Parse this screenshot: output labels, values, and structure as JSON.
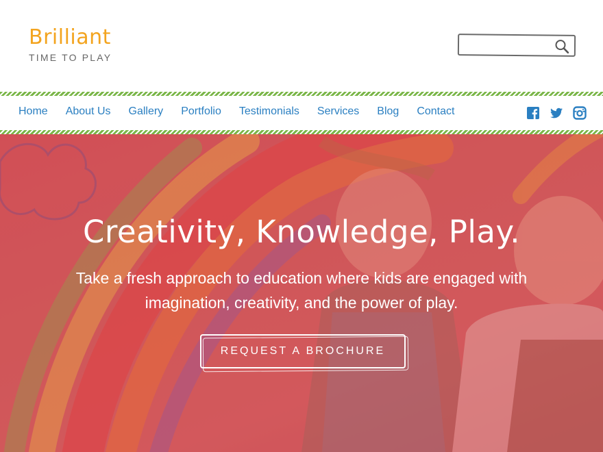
{
  "brand": {
    "name": "Brilliant",
    "tagline": "TIME TO PLAY"
  },
  "search": {
    "value": "",
    "placeholder": "",
    "icon": "search-icon"
  },
  "nav": {
    "items": [
      {
        "label": "Home"
      },
      {
        "label": "About Us"
      },
      {
        "label": "Gallery"
      },
      {
        "label": "Portfolio"
      },
      {
        "label": "Testimonials"
      },
      {
        "label": "Services"
      },
      {
        "label": "Blog"
      },
      {
        "label": "Contact"
      }
    ],
    "social": [
      "facebook-icon",
      "twitter-icon",
      "instagram-icon"
    ]
  },
  "hero": {
    "title": "Creativity, Knowledge, Play.",
    "subtitle": "Take a fresh approach to education where kids are engaged with imagination, creativity, and the power of play.",
    "cta_label": "REQUEST A BROCHURE"
  },
  "colors": {
    "brand_orange": "#f3a41f",
    "nav_blue": "#2a7fc1",
    "stripe_green": "#7ab648",
    "hero_overlay": "#d24f57"
  }
}
